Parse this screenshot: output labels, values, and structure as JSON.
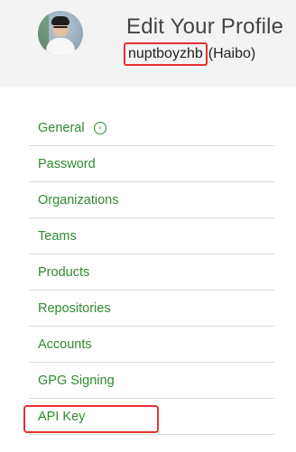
{
  "profile": {
    "title": "Edit Your Profile",
    "username": "nuptboyzhb",
    "fullname": "(Haibo)"
  },
  "menu": {
    "items": [
      {
        "label": "General",
        "icon": "chevron-right-circle-icon"
      },
      {
        "label": "Password"
      },
      {
        "label": "Organizations"
      },
      {
        "label": "Teams"
      },
      {
        "label": "Products"
      },
      {
        "label": "Repositories"
      },
      {
        "label": "Accounts"
      },
      {
        "label": "GPG Signing"
      },
      {
        "label": "API Key"
      }
    ]
  },
  "colors": {
    "link": "#2e8b2e",
    "highlight": "#e5302f",
    "header_bg": "#f3f3f3"
  }
}
